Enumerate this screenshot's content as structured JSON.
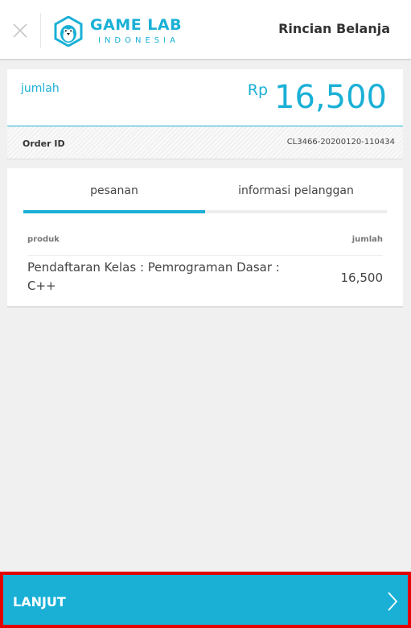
{
  "header": {
    "logo_title": "GAME LAB",
    "logo_subtitle": "INDONESIA",
    "title": "Rincian Belanja"
  },
  "amount": {
    "label": "jumlah",
    "currency": "Rp",
    "value": "16,500"
  },
  "order": {
    "label": "Order ID",
    "value": "CL3466-20200120-110434"
  },
  "tabs": [
    {
      "label": "pesanan",
      "active": true
    },
    {
      "label": "informasi pelanggan",
      "active": false
    }
  ],
  "table": {
    "columns": [
      "produk",
      "jumlah"
    ],
    "rows": [
      {
        "product": "Pendaftaran Kelas : Pemrograman Dasar : C++",
        "amount": "16,500"
      }
    ]
  },
  "footer": {
    "button_label": "LANJUT"
  },
  "colors": {
    "accent": "#1ab0d6",
    "highlight_outline": "#e30000"
  }
}
